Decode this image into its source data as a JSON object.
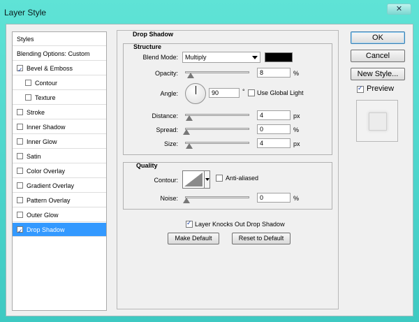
{
  "window": {
    "title": "Layer Style",
    "close_glyph": "✕"
  },
  "styles_list": {
    "header": "Styles",
    "blending": "Blending Options: Custom",
    "items": [
      {
        "label": "Bevel & Emboss",
        "checked": true,
        "indent": false
      },
      {
        "label": "Contour",
        "checked": false,
        "indent": true
      },
      {
        "label": "Texture",
        "checked": false,
        "indent": true
      },
      {
        "label": "Stroke",
        "checked": false,
        "indent": false
      },
      {
        "label": "Inner Shadow",
        "checked": false,
        "indent": false
      },
      {
        "label": "Inner Glow",
        "checked": false,
        "indent": false
      },
      {
        "label": "Satin",
        "checked": false,
        "indent": false
      },
      {
        "label": "Color Overlay",
        "checked": false,
        "indent": false
      },
      {
        "label": "Gradient Overlay",
        "checked": false,
        "indent": false
      },
      {
        "label": "Pattern Overlay",
        "checked": false,
        "indent": false
      },
      {
        "label": "Outer Glow",
        "checked": false,
        "indent": false
      },
      {
        "label": "Drop Shadow",
        "checked": true,
        "indent": false,
        "selected": true
      }
    ]
  },
  "drop_shadow": {
    "title": "Drop Shadow",
    "structure": {
      "title": "Structure",
      "blend_mode_label": "Blend Mode:",
      "blend_mode_value": "Multiply",
      "shadow_color": "#000000",
      "opacity_label": "Opacity:",
      "opacity_value": "8",
      "opacity_unit": "%",
      "angle_label": "Angle:",
      "angle_value": "90",
      "angle_unit": "°",
      "use_global_light_label": "Use Global Light",
      "use_global_light": false,
      "distance_label": "Distance:",
      "distance_value": "4",
      "distance_unit": "px",
      "spread_label": "Spread:",
      "spread_value": "0",
      "spread_unit": "%",
      "size_label": "Size:",
      "size_value": "4",
      "size_unit": "px"
    },
    "quality": {
      "title": "Quality",
      "contour_label": "Contour:",
      "anti_aliased_label": "Anti-aliased",
      "anti_aliased": false,
      "noise_label": "Noise:",
      "noise_value": "0",
      "noise_unit": "%"
    },
    "knocks_out_label": "Layer Knocks Out Drop Shadow",
    "knocks_out": true,
    "make_default_label": "Make Default",
    "reset_default_label": "Reset to Default"
  },
  "buttons": {
    "ok": "OK",
    "cancel": "Cancel",
    "new_style": "New Style...",
    "preview_label": "Preview",
    "preview_checked": true
  },
  "colors": {
    "selection": "#3399ff",
    "title_bar": "#4fd6cc"
  }
}
